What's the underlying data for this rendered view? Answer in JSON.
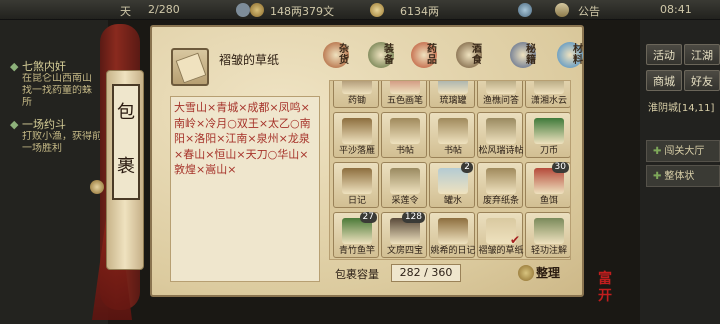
{
  "topbar": {
    "day": "天",
    "hp": "2/280",
    "money": "148两379文",
    "silver": "6134两",
    "announcement": "公告",
    "time": "08:41"
  },
  "quest": {
    "items": [
      {
        "title": "七煞内奸",
        "lines": [
          "在昆仑山西南山",
          "找一找药童的蛛",
          "所"
        ]
      },
      {
        "title": "一场约斗",
        "lines": [
          "打败小渔，获得前",
          "一场胜利"
        ]
      }
    ]
  },
  "right_menu": {
    "buttons": [
      "活动",
      "江湖",
      "商城",
      "好友"
    ],
    "partial": "淮阴城",
    "partial_coord": "[14,11]",
    "tabs": [
      "闯关大厅",
      "整体状"
    ]
  },
  "scroll_tag": {
    "label1": "包",
    "label2": "裹"
  },
  "selected_item": {
    "name": "褶皱的草纸"
  },
  "categories": [
    {
      "label": "杂货",
      "color": "#a8542a"
    },
    {
      "label": "装备",
      "color": "#5a6d3a"
    },
    {
      "label": "药品",
      "color": "#b94a2a"
    },
    {
      "label": "酒食",
      "color": "#6a5030"
    },
    {
      "label": "秘籍",
      "color": "#4c5f86"
    },
    {
      "label": "材料",
      "color": "#3d87c4"
    }
  ],
  "description": "大雪山×青城×成都×凤鸣×南岭×冷月○双王×太乙○南阳×洛阳×江南×泉州×龙泉×春山×恒山×天刀○华山×敦煌×嵩山×",
  "grid_items": [
    {
      "label": "药锄",
      "color": "#7a5c38"
    },
    {
      "label": "五色画笔",
      "color": "#b8584a"
    },
    {
      "label": "琉璃罐",
      "color": "#6d8ca0"
    },
    {
      "label": "渔樵问答",
      "color": "#8a7a50"
    },
    {
      "label": "潇湘水云",
      "color": "#8a7a50"
    },
    {
      "label": "平沙落雁",
      "color": "#8d6e3e"
    },
    {
      "label": "书帖",
      "color": "#a08a5c"
    },
    {
      "label": "书帖",
      "color": "#a08a5c"
    },
    {
      "label": "松风瑞诗帖",
      "color": "#9a8a60"
    },
    {
      "label": "刀币",
      "color": "#3f7a3a"
    },
    {
      "label": "日记",
      "color": "#8d6e3e"
    },
    {
      "label": "采莲令",
      "color": "#9a8a60"
    },
    {
      "label": "罐水",
      "color": "#b4cbd3",
      "count": "2"
    },
    {
      "label": "废弃纸条",
      "color": "#a08a5c"
    },
    {
      "label": "鱼饵",
      "color": "#b54a3a",
      "count": "30"
    },
    {
      "label": "青竹鱼竿",
      "color": "#4b7a38",
      "count": "27"
    },
    {
      "label": "文房四宝",
      "color": "#5a4a3a",
      "count": "128"
    },
    {
      "label": "姚希的日记",
      "color": "#8d6e3e"
    },
    {
      "label": "褶皱的草纸",
      "color": "#d9c9a0",
      "checked": true
    },
    {
      "label": "轻功注解",
      "color": "#7a8a5a"
    }
  ],
  "capacity": {
    "label": "包裹容量",
    "value": "282 / 360"
  },
  "sort": {
    "label": "整理"
  },
  "stamp": {
    "text": "富开"
  }
}
